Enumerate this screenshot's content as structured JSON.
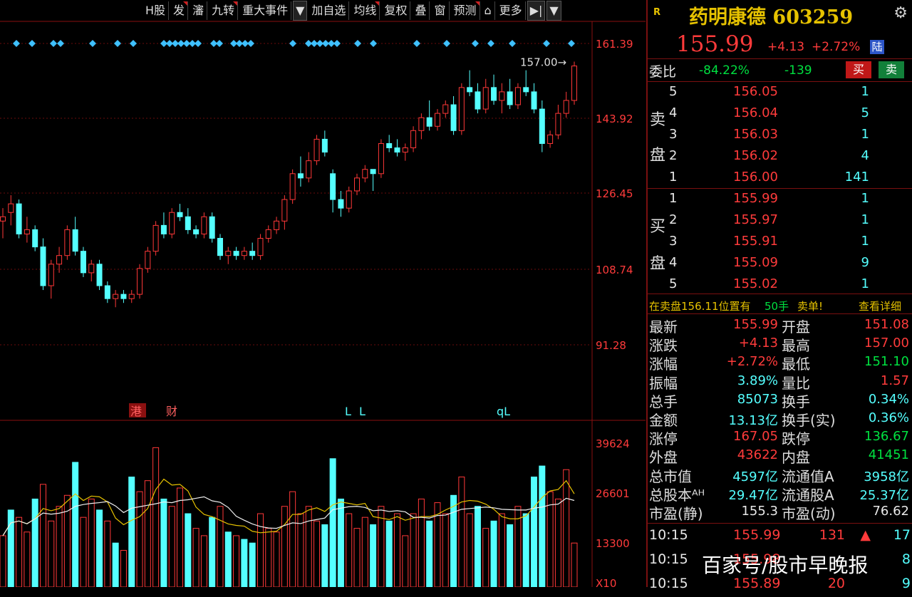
{
  "toolbar": {
    "items": [
      {
        "label": "H股",
        "flag": false
      },
      {
        "label": "发",
        "flag": true
      },
      {
        "label": "瀋",
        "flag": false
      },
      {
        "label": "九转",
        "flag": true
      },
      {
        "label": "重大事件",
        "flag": false
      },
      {
        "label": "▼",
        "flag": false,
        "dd": true
      },
      {
        "label": "加自选",
        "flag": false
      },
      {
        "label": "均线",
        "flag": true
      },
      {
        "label": "复权",
        "flag": false
      },
      {
        "label": "叠",
        "flag": false
      },
      {
        "label": "窗",
        "flag": false
      },
      {
        "label": "预测",
        "flag": true
      },
      {
        "label": "⌂",
        "flag": false
      },
      {
        "label": "更多",
        "flag": false
      },
      {
        "label": "▶|",
        "flag": false,
        "dd": true
      },
      {
        "label": "▼",
        "flag": false,
        "dd": true
      }
    ]
  },
  "chart": {
    "price_axis": [
      "161.39",
      "143.92",
      "126.45",
      "108.74",
      "91.28"
    ],
    "volume_axis": [
      "39624",
      "26601",
      "13300",
      "X10"
    ],
    "high_label": "157.00",
    "event_markers": [
      {
        "text": "港",
        "boxed": true
      },
      {
        "text": "财",
        "boxed": false
      },
      {
        "text": "L",
        "boxed": false
      },
      {
        "text": "L",
        "boxed": false
      },
      {
        "text": "qL",
        "boxed": false
      }
    ]
  },
  "chart_data": {
    "type": "candlestick",
    "ylim": [
      91.28,
      161.39
    ],
    "candles": [
      [
        120,
        123,
        116,
        121
      ],
      [
        122,
        126,
        119,
        124
      ],
      [
        124,
        125,
        116,
        117
      ],
      [
        117,
        121,
        115,
        118
      ],
      [
        118,
        119,
        113,
        114
      ],
      [
        114,
        116,
        104,
        105
      ],
      [
        105,
        111,
        102,
        110
      ],
      [
        110,
        114,
        108,
        112
      ],
      [
        112,
        119,
        111,
        118
      ],
      [
        118,
        121,
        112,
        113
      ],
      [
        113,
        114,
        107,
        108
      ],
      [
        108,
        111,
        106,
        110
      ],
      [
        110,
        111,
        104,
        105
      ],
      [
        105,
        106,
        101,
        102
      ],
      [
        102,
        104,
        100,
        103
      ],
      [
        103,
        104,
        101,
        102
      ],
      [
        102,
        104,
        101,
        103
      ],
      [
        103,
        110,
        102,
        109
      ],
      [
        109,
        114,
        108,
        113
      ],
      [
        113,
        120,
        112,
        119
      ],
      [
        119,
        122,
        116,
        117
      ],
      [
        117,
        123,
        116,
        122
      ],
      [
        122,
        124,
        120,
        121
      ],
      [
        121,
        123,
        117,
        118
      ],
      [
        118,
        119,
        116,
        117
      ],
      [
        117,
        122,
        116,
        121
      ],
      [
        121,
        122,
        115,
        116
      ],
      [
        116,
        117,
        111,
        112
      ],
      [
        112,
        114,
        110,
        113
      ],
      [
        113,
        114,
        111,
        112
      ],
      [
        112,
        114,
        111,
        113
      ],
      [
        113,
        115,
        111,
        112
      ],
      [
        112,
        117,
        111,
        116
      ],
      [
        116,
        119,
        115,
        118
      ],
      [
        118,
        121,
        117,
        120
      ],
      [
        120,
        126,
        118,
        125
      ],
      [
        125,
        132,
        124,
        131
      ],
      [
        131,
        135,
        128,
        130
      ],
      [
        130,
        136,
        129,
        134
      ],
      [
        134,
        140,
        133,
        139
      ],
      [
        139,
        141,
        135,
        136
      ],
      [
        131,
        132,
        122,
        125
      ],
      [
        125,
        127,
        121,
        123
      ],
      [
        123,
        128,
        122,
        127
      ],
      [
        127,
        131,
        126,
        130
      ],
      [
        130,
        133,
        129,
        132
      ],
      [
        132,
        131,
        127,
        131
      ],
      [
        131,
        139,
        130,
        138
      ],
      [
        138,
        140,
        136,
        137
      ],
      [
        137,
        139,
        135,
        136
      ],
      [
        136,
        138,
        134,
        137
      ],
      [
        137,
        142,
        136,
        141
      ],
      [
        141,
        145,
        139,
        144
      ],
      [
        144,
        148,
        141,
        142
      ],
      [
        142,
        146,
        141,
        145
      ],
      [
        145,
        148,
        144,
        147
      ],
      [
        147,
        149,
        140,
        141
      ],
      [
        141,
        152,
        140,
        151
      ],
      [
        151,
        155,
        149,
        150
      ],
      [
        150,
        152,
        145,
        146
      ],
      [
        146,
        153,
        145,
        151
      ],
      [
        151,
        154,
        147,
        148
      ],
      [
        148,
        152,
        145,
        150
      ],
      [
        150,
        153,
        146,
        147
      ],
      [
        147,
        152,
        146,
        151
      ],
      [
        151,
        155,
        149,
        150
      ],
      [
        150,
        152,
        145,
        146
      ],
      [
        146,
        148,
        136,
        138
      ],
      [
        138,
        141,
        137,
        140
      ],
      [
        140,
        147,
        139,
        145
      ],
      [
        145,
        150,
        144,
        148
      ],
      [
        148,
        157,
        147,
        156
      ]
    ],
    "volume": [
      [
        14000,
        "r"
      ],
      [
        21000,
        "c"
      ],
      [
        19000,
        "r"
      ],
      [
        15000,
        "r"
      ],
      [
        24000,
        "c"
      ],
      [
        28000,
        "r"
      ],
      [
        18000,
        "r"
      ],
      [
        22000,
        "r"
      ],
      [
        25000,
        "r"
      ],
      [
        34000,
        "c"
      ],
      [
        19000,
        "r"
      ],
      [
        24000,
        "r"
      ],
      [
        21000,
        "c"
      ],
      [
        18000,
        "r"
      ],
      [
        12000,
        "c"
      ],
      [
        10000,
        "r"
      ],
      [
        30000,
        "c"
      ],
      [
        26000,
        "r"
      ],
      [
        29000,
        "r"
      ],
      [
        38000,
        "r"
      ],
      [
        24000,
        "c"
      ],
      [
        22000,
        "r"
      ],
      [
        27000,
        "r"
      ],
      [
        20000,
        "c"
      ],
      [
        16000,
        "r"
      ],
      [
        14000,
        "r"
      ],
      [
        19000,
        "c"
      ],
      [
        22000,
        "r"
      ],
      [
        15000,
        "c"
      ],
      [
        14000,
        "r"
      ],
      [
        13000,
        "c"
      ],
      [
        12000,
        "c"
      ],
      [
        20000,
        "r"
      ],
      [
        16000,
        "r"
      ],
      [
        15000,
        "r"
      ],
      [
        22000,
        "r"
      ],
      [
        26000,
        "r"
      ],
      [
        20000,
        "r"
      ],
      [
        22000,
        "r"
      ],
      [
        18000,
        "r"
      ],
      [
        17000,
        "c"
      ],
      [
        35000,
        "c"
      ],
      [
        24000,
        "c"
      ],
      [
        20000,
        "r"
      ],
      [
        16000,
        "r"
      ],
      [
        19000,
        "r"
      ],
      [
        17000,
        "c"
      ],
      [
        22000,
        "r"
      ],
      [
        18000,
        "c"
      ],
      [
        20000,
        "r"
      ],
      [
        14000,
        "r"
      ],
      [
        20000,
        "r"
      ],
      [
        24000,
        "r"
      ],
      [
        18000,
        "c"
      ],
      [
        23000,
        "r"
      ],
      [
        20000,
        "r"
      ],
      [
        25000,
        "c"
      ],
      [
        30000,
        "r"
      ],
      [
        20000,
        "r"
      ],
      [
        22000,
        "c"
      ],
      [
        16000,
        "r"
      ],
      [
        18000,
        "c"
      ],
      [
        20000,
        "r"
      ],
      [
        17000,
        "c"
      ],
      [
        22000,
        "r"
      ],
      [
        20000,
        "c"
      ],
      [
        30000,
        "c"
      ],
      [
        33000,
        "c"
      ],
      [
        26000,
        "r"
      ],
      [
        24000,
        "r"
      ],
      [
        32000,
        "r"
      ],
      [
        12000,
        "r"
      ]
    ],
    "ylim_volume": [
      0,
      39624
    ]
  },
  "panel": {
    "r_tag": "R",
    "name": "药明康德",
    "code": "603259",
    "price": "155.99",
    "change": "+4.13",
    "change_pct": "+2.72%",
    "market_tag": "陆",
    "weibi_label": "委比",
    "weibi_pct": "-84.22%",
    "weibi_diff": "-139",
    "buy_btn": "买",
    "sell_btn": "卖",
    "sell_side_label": [
      "卖",
      "盘"
    ],
    "buy_side_label": [
      "买",
      "盘"
    ],
    "asks": [
      {
        "lvl": "5",
        "price": "156.05",
        "vol": "1"
      },
      {
        "lvl": "4",
        "price": "156.04",
        "vol": "5"
      },
      {
        "lvl": "3",
        "price": "156.03",
        "vol": "1"
      },
      {
        "lvl": "2",
        "price": "156.02",
        "vol": "4"
      },
      {
        "lvl": "1",
        "price": "156.00",
        "vol": "141"
      }
    ],
    "bids": [
      {
        "lvl": "1",
        "price": "155.99",
        "vol": "1"
      },
      {
        "lvl": "2",
        "price": "155.97",
        "vol": "1"
      },
      {
        "lvl": "3",
        "price": "155.91",
        "vol": "1"
      },
      {
        "lvl": "4",
        "price": "155.09",
        "vol": "9"
      },
      {
        "lvl": "5",
        "price": "155.02",
        "vol": "1"
      }
    ],
    "notice_a": "在卖盘156.11位置有",
    "notice_b": "50手",
    "notice_c": "卖单!",
    "notice_link": "查看详细",
    "quotes": [
      {
        "l1": "最新",
        "v1": "155.99",
        "c1": "red",
        "l2": "开盘",
        "v2": "151.08",
        "c2": "red"
      },
      {
        "l1": "涨跌",
        "v1": "+4.13",
        "c1": "red",
        "l2": "最高",
        "v2": "157.00",
        "c2": "red"
      },
      {
        "l1": "涨幅",
        "v1": "+2.72%",
        "c1": "red",
        "l2": "最低",
        "v2": "151.10",
        "c2": "green"
      },
      {
        "l1": "振幅",
        "v1": "3.89%",
        "c1": "cyan",
        "l2": "量比",
        "v2": "1.57",
        "c2": "red"
      },
      {
        "l1": "总手",
        "v1": "85073",
        "c1": "cyan",
        "l2": "换手",
        "v2": "0.34%",
        "c2": "cyan"
      },
      {
        "l1": "金额",
        "v1": "13.13亿",
        "c1": "cyan",
        "l2": "换手(实)",
        "v2": "0.36%",
        "c2": "cyan"
      },
      {
        "l1": "涨停",
        "v1": "167.05",
        "c1": "red",
        "l2": "跌停",
        "v2": "136.67",
        "c2": "green"
      },
      {
        "l1": "外盘",
        "v1": "43622",
        "c1": "red",
        "l2": "内盘",
        "v2": "41451",
        "c2": "green"
      },
      {
        "l1": "总市值",
        "v1": "4597亿",
        "c1": "cyan",
        "l2": "流通值A",
        "v2": "3958亿",
        "c2": "cyan"
      },
      {
        "l1": "总股本ᴬᴴ",
        "v1": "29.47亿",
        "c1": "cyan",
        "l2": "流通股A",
        "v2": "25.37亿",
        "c2": "cyan"
      },
      {
        "l1": "市盈(静)",
        "v1": "155.3",
        "c1": "white",
        "l2": "市盈(动)",
        "v2": "76.62",
        "c2": "white"
      }
    ],
    "ticks": [
      {
        "time": "10:15",
        "price": "155.99",
        "vol": "131",
        "num": "17"
      },
      {
        "time": "10:15",
        "price": "155.98",
        "vol": "",
        "num": "8"
      },
      {
        "time": "10:15",
        "price": "155.89",
        "vol": "20",
        "num": "9"
      }
    ],
    "watermark": "百家号/股市早晚报"
  }
}
